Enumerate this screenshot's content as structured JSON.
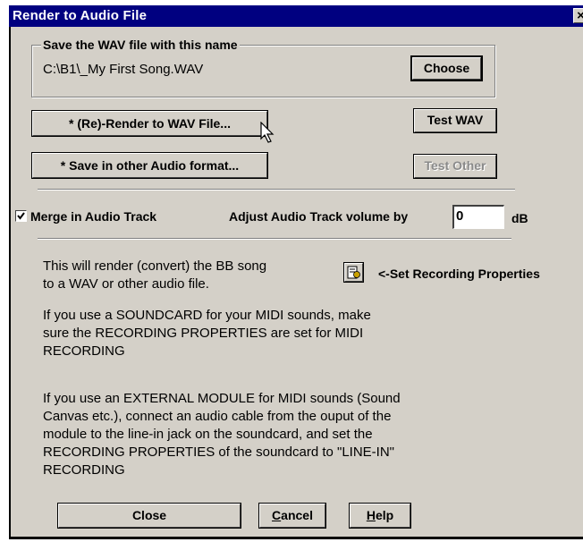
{
  "window": {
    "title": "Render to Audio File",
    "close_glyph": "×"
  },
  "save_group": {
    "label": "Save the WAV file with this name",
    "filename": "C:\\B1\\_My First Song.WAV",
    "choose_label": "Choose"
  },
  "buttons": {
    "render_wav": "* (Re)-Render to WAV File...",
    "save_other": "* Save in other Audio format...",
    "test_wav": "Test WAV",
    "test_other": "Test Other",
    "close": "Close",
    "cancel_prefix": "C",
    "cancel_rest": "ancel",
    "help_prefix": "H",
    "help_rest": "elp"
  },
  "audio_track": {
    "merge_label": "Merge in Audio Track",
    "merge_checked": true,
    "volume_label": "Adjust Audio Track volume by",
    "volume_value": "0",
    "volume_unit": "dB"
  },
  "info": {
    "render_line1": "This will render (convert) the BB song",
    "render_line2": "to a WAV or other audio file.",
    "set_props_label": "<-Set Recording Properties",
    "soundcard_line1": "If you use a SOUNDCARD for your MIDI sounds, make",
    "soundcard_line2": "sure the RECORDING PROPERTIES are set for MIDI",
    "soundcard_line3": "RECORDING",
    "external_line1": "If you use an EXTERNAL MODULE for MIDI sounds (Sound",
    "external_line2": "Canvas etc.),  connect an audio cable from the ouput of the",
    "external_line3": "module to the line-in jack on the soundcard, and set the",
    "external_line4": "RECORDING PROPERTIES of the soundcard to \"LINE-IN\"",
    "external_line5": "RECORDING"
  }
}
